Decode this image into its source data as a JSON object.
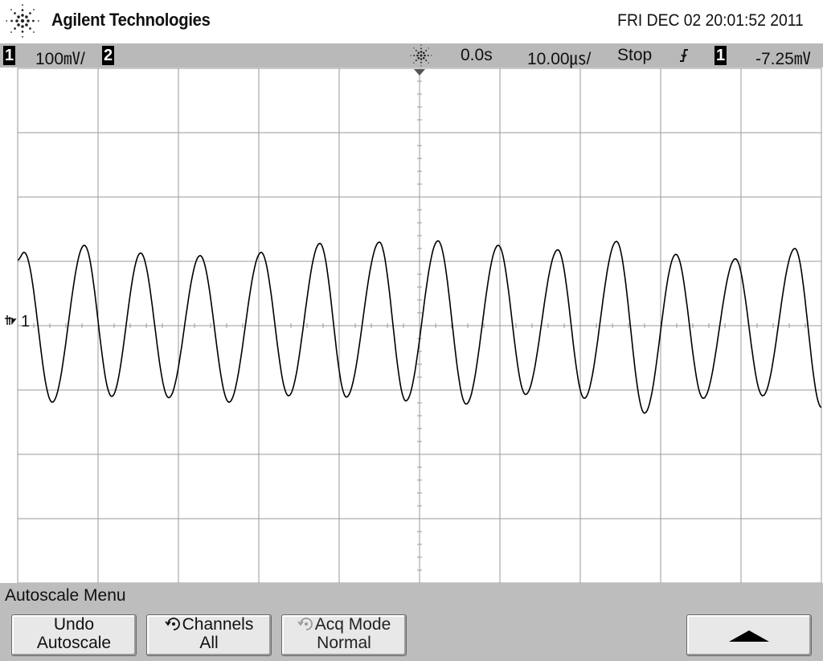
{
  "header": {
    "brand": "Agilent Technologies",
    "datetime": "FRI DEC 02 20:01:52 2011",
    "logo_icon": "agilent-spark-logo"
  },
  "status": {
    "ch1_number": "1",
    "ch1_scale": "100㎷/",
    "ch2_number": "2",
    "trigger_icon": "trigger-spark-icon",
    "delay": "0.0s",
    "timebase": "10.00㎲/",
    "run_state": "Stop",
    "edge_icon": "falling-edge-icon",
    "trig_source": "1",
    "trig_level": "-7.25㎷"
  },
  "scope": {
    "ground_label": "1",
    "grid_divisions": {
      "x": 10,
      "y": 8
    },
    "trace_color": "#000000",
    "grid_color": "#9a9a9a"
  },
  "chart_data": {
    "type": "line",
    "description_units": "x in divisions (0-10), y in divisions (-4 to 4, 0 = channel 1 ground)",
    "xlim": [
      0,
      10
    ],
    "ylim": [
      -4,
      4
    ],
    "grid": true,
    "series": [
      {
        "peaks_x": [
          0.08,
          0.83,
          1.53,
          2.27,
          3.03,
          3.76,
          4.5,
          5.23,
          5.98,
          6.72,
          7.45,
          8.19,
          8.93,
          9.67
        ],
        "peaks_y": [
          1.14,
          1.25,
          1.13,
          1.09,
          1.14,
          1.28,
          1.3,
          1.32,
          1.25,
          1.18,
          1.31,
          1.11,
          1.04,
          1.2
        ],
        "troughs_x": [
          0.43,
          1.17,
          1.88,
          2.63,
          3.37,
          4.09,
          4.83,
          5.58,
          6.32,
          7.05,
          7.8,
          8.53,
          9.27
        ],
        "troughs_y": [
          -1.19,
          -1.1,
          -1.12,
          -1.19,
          -1.09,
          -1.11,
          -1.17,
          -1.22,
          -1.07,
          -1.13,
          -1.36,
          -1.13,
          -1.09
        ],
        "start_y": 1.02,
        "end_y": -1.27
      }
    ]
  },
  "menu": {
    "title": "Autoscale Menu",
    "undo_l1": "Undo",
    "undo_l2": "Autoscale",
    "channels_l1": "Channels",
    "channels_l2": "All",
    "channels_icon": "rotate-knob-icon",
    "acq_l1": "Acq Mode",
    "acq_l2": "Normal",
    "acq_icon": "rotate-knob-icon",
    "up_icon": "up-arrow-icon"
  }
}
